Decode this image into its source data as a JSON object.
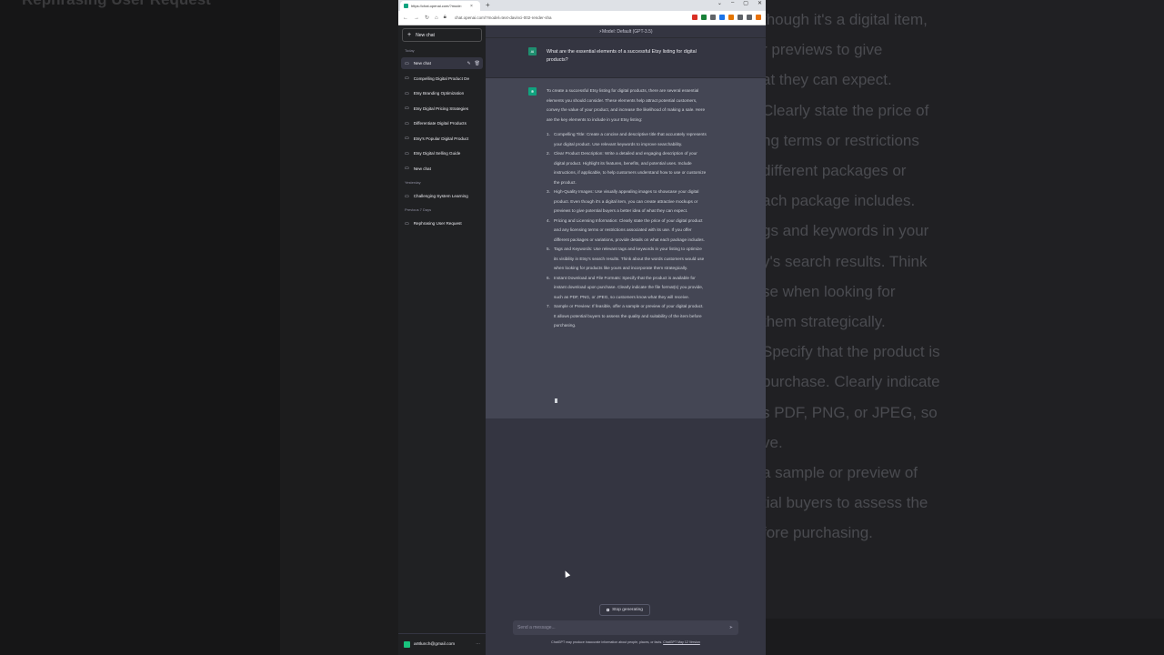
{
  "background": {
    "left_title": "Rephrasing User Request",
    "right_lines": [
      " though it's a digital item,",
      "r previews to give",
      "at they can expect.",
      "Clearly state the price of",
      "ng terms or restrictions",
      "different packages or",
      "ach package includes.",
      "gs and keywords in your",
      "y's search results. Think",
      "se when looking for",
      " them strategically.",
      "Specify that the product is",
      " purchase. Clearly indicate",
      "s PDF, PNG, or JPEG, so",
      "ve.",
      "a sample or preview of",
      "tial buyers to assess the",
      "fore purchasing."
    ]
  },
  "browser": {
    "tab_title": "https://chat.openai.com/?mode:",
    "tab_close": "×",
    "new_tab": "+",
    "window_controls": [
      "⌄",
      "–",
      "▢",
      "✕"
    ],
    "url": "chat.openai.com/?model=text-davinci-002-render-sha",
    "ext_colors": [
      "#d93025",
      "#188038",
      "#5f6368",
      "#1a73e8",
      "#e37400",
      "#5f6368",
      "#5f6368",
      "#e8710a"
    ]
  },
  "sidebar": {
    "new_chat_label": "New chat",
    "today_label": "Today",
    "today_items": [
      "New chat",
      "Compelling Digital Product De",
      "Etsy Branding Optimization",
      "Etsy Digital Pricing Strategies",
      "Differentiate Digital Products",
      "Etsy's Popular Digital Product",
      "Etsy Digital Selling Guide",
      "New chat"
    ],
    "yesterday_label": "Yesterday",
    "yesterday_items": [
      "Challenging System Learning"
    ],
    "prev7_label": "Previous 7 Days",
    "prev7_items": [
      "Rephrasing User Request"
    ],
    "user_email": "ar8lunch@gmail.com"
  },
  "main": {
    "model_label": "Model: Default (GPT-3.5)",
    "user_avatar": "AI",
    "user_message": "What are the essential elements of a successful Etsy listing for digital products?",
    "assistant_intro": "To create a successful Etsy listing for digital products, there are several essential elements you should consider. These elements help attract potential customers, convey the value of your product, and increase the likelihood of making a sale. Here are the key elements to include in your Etsy listing:",
    "list_items": [
      "Compelling Title: Create a concise and descriptive title that accurately represents your digital product. Use relevant keywords to improve searchability.",
      "Clear Product Description: Write a detailed and engaging description of your digital product. Highlight its features, benefits, and potential uses. Include instructions, if applicable, to help customers understand how to use or customize the product.",
      "High-Quality Images: Use visually appealing images to showcase your digital product. Even though it's a digital item, you can create attractive mockups or previews to give potential buyers a better idea of what they can expect.",
      "Pricing and Licensing Information: Clearly state the price of your digital product and any licensing terms or restrictions associated with its use. If you offer different packages or variations, provide details on what each package includes.",
      "Tags and Keywords: Use relevant tags and keywords in your listing to optimize its visibility in Etsy's search results. Think about the words customers would use when looking for products like yours and incorporate them strategically.",
      "Instant Download and File Formats: Specify that the product is available for instant download upon purchase. Clearly indicate the file format(s) you provide, such as PDF, PNG, or JPEG, so customers know what they will receive.",
      "Sample or Preview: If feasible, offer a sample or preview of your digital product. It allows potential buyers to assess the quality and suitability of the item before purchasing."
    ],
    "stop_label": "Stop generating",
    "input_placeholder": "Send a message...",
    "disclaimer": "ChatGPT may produce inaccurate information about people, places, or facts. ",
    "disclaimer_link": "ChatGPT May 12 Version"
  }
}
